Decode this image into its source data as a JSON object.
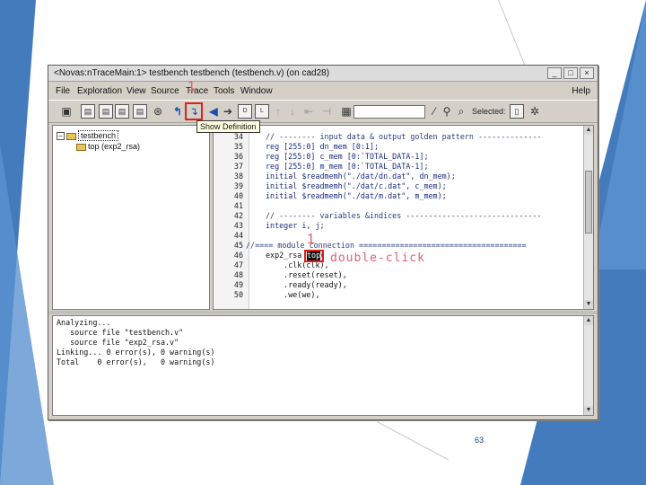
{
  "window": {
    "title": "<Novas:nTraceMain:1> testbench testbench (testbench.v) (on cad28)",
    "buttons": [
      "_",
      "□",
      "×"
    ]
  },
  "menu": {
    "items": [
      "File",
      "Exploration",
      "View",
      "Source",
      "Trace",
      "Tools",
      "Window"
    ],
    "help": "Help"
  },
  "toolbar": {
    "selected_label": "Selected:",
    "combo_value": "",
    "tooltip": "Show Definition"
  },
  "annotations": {
    "marker_1a": "1",
    "marker_1b": "1",
    "callout": "double-click"
  },
  "tree": {
    "root": "testbench",
    "root_toggle": "−",
    "child": "top (exp2_rsa)",
    "child_toggle": "+"
  },
  "source": {
    "lines": [
      {
        "n": "34",
        "t": "// -------- input data & output golden pattern --------------"
      },
      {
        "n": "35",
        "t": "reg [255:0] dn_mem [0:1];"
      },
      {
        "n": "36",
        "t": "reg [255:0] c_mem [0:`TOTAL_DATA-1];"
      },
      {
        "n": "37",
        "t": "reg [255:0] m_mem [0:`TOTAL_DATA-1];"
      },
      {
        "n": "38",
        "t": "initial $readmemh(\"./dat/dn.dat\", dn_mem);"
      },
      {
        "n": "39",
        "t": "initial $readmemh(\"./dat/c.dat\", c_mem);"
      },
      {
        "n": "40",
        "t": "initial $readmemh(\"./dat/m.dat\", m_mem);"
      },
      {
        "n": "41",
        "t": ""
      },
      {
        "n": "42",
        "t": "// -------- variables &indices ------------------------------"
      },
      {
        "n": "43",
        "t": "integer i, j;"
      },
      {
        "n": "44",
        "t": ""
      },
      {
        "n": "45",
        "t": "//==== module connection ====================================="
      },
      {
        "n": "46",
        "t": "exp2_rsa top("
      },
      {
        "n": "47",
        "t": "    .clk(clk),"
      },
      {
        "n": "48",
        "t": "    .reset(reset),"
      },
      {
        "n": "49",
        "t": "    .ready(ready),"
      },
      {
        "n": "50",
        "t": "    .we(we),"
      }
    ],
    "highlight_word": "top"
  },
  "log": {
    "lines": [
      "Analyzing...",
      "   source file \"testbench.v\"",
      "   source file \"exp2_rsa.v\"",
      "Linking... 0 error(s), 0 warning(s)",
      "Total    0 error(s),   0 warning(s)"
    ]
  },
  "slide": {
    "page_number": "63"
  },
  "colors": {
    "annotation_red": "#e0201c",
    "code_blue": "#1a2a80",
    "identifier_red": "#c0002a",
    "accent_blue": "#2f6db5"
  }
}
